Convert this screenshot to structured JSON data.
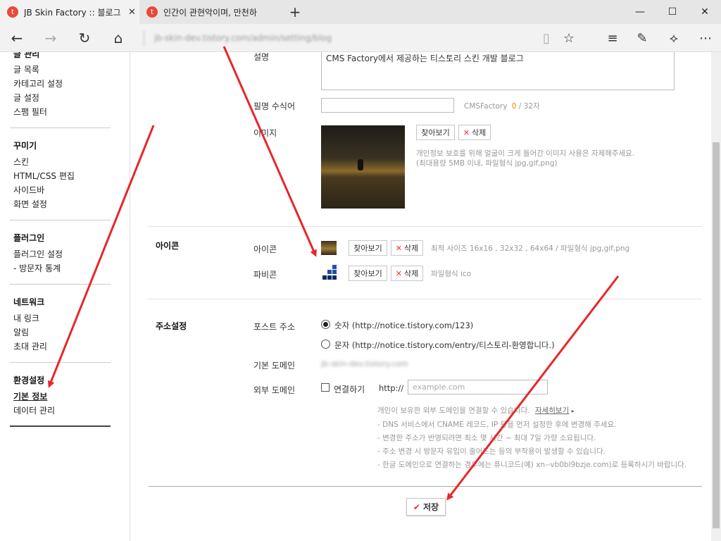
{
  "browser": {
    "tabs": [
      {
        "title": "JB Skin Factory :: 블로그",
        "icon": "tistory-icon",
        "close": "✕"
      },
      {
        "title": "인간이 관현악이며, 만천하",
        "icon": "tistory-icon"
      }
    ],
    "new_tab": "+",
    "address": "jb-skin-dev.tistory.com/admin/setting/blog"
  },
  "sidebar": {
    "top_header": "글 관리",
    "group1": [
      "글 목록",
      "카테고리 설정",
      "글 설정",
      "스팸 필터"
    ],
    "design": {
      "header": "꾸미기",
      "items": [
        "스킨",
        "HTML/CSS 편집",
        "사이드바",
        "화면 설정"
      ]
    },
    "plugin": {
      "header": "플러그인",
      "items": [
        "플러그인 설정",
        "- 방문자 통계"
      ]
    },
    "network": {
      "header": "네트워크",
      "items": [
        "내 링크",
        "알림",
        "초대 관리"
      ]
    },
    "settings": {
      "header": "환경설정",
      "items": [
        "기본 정보",
        "데이터 관리"
      ]
    }
  },
  "form": {
    "desc_label": "설명",
    "desc_value": "CMS Factory에서 제공하는 티스토리 스킨 개발 블로그",
    "nick_label": "필명 수식어",
    "nick_hint_prefix": "CMSFactory",
    "nick_count": "0",
    "nick_max": "/ 32자",
    "image_label": "이미지",
    "browse": "찾아보기",
    "delete": "삭제",
    "image_hint1": "개인정보 보호를 위해 얼굴이 크게 들어간 이미지 사용은 자제해주세요.",
    "image_hint2": "(최대용량 5MB 이내, 파일형식 jpg,gif,png)",
    "icon_section": "아이콘",
    "icon_label": "아이콘",
    "icon_hint": "최적 사이즈 16x16 , 32x32 , 64x64 / 파일형식 jpg,gif,png",
    "favicon_label": "파비콘",
    "favicon_hint": "파일형식 ico",
    "addr_section": "주소설정",
    "post_addr_label": "포스트 주소",
    "opt_number": "숫자 (http://notice.tistory.com/123)",
    "opt_text": "문자 (http://notice.tistory.com/entry/티스토리-환영합니다.)",
    "base_domain_label": "기본 도메인",
    "base_domain_value": "jb-skin-dev.tistory.com",
    "ext_domain_label": "외부 도메인",
    "connect_label": "연결하기",
    "http_prefix": "http://",
    "domain_placeholder": "example.com",
    "ext_info1": "개인이 보유한 외부 도메인을 연결할 수 있습니다.",
    "ext_more": "자세히보기",
    "ext_info2": "- DNS 서비스에서 CNAME 레코드, IP 등을 먼저 설정한 후에 변경해 주세요.",
    "ext_info3": "- 변경한 주소가 반영되려면 최소 몇 시간 ~ 최대 7일 가량 소요됩니다.",
    "ext_info4": "- 주소 변경 시 방문자 유입이 줄어드는 등의 부작용이 발생할 수 있습니다.",
    "ext_info5": "- 한글 도메인으로 연결하는 경우에는 퓨니코드(예) xn--vb0bl9bzje.com)로 등록하시기 바랍니다.",
    "save": "저장"
  },
  "colors": {
    "accent_arrow": "#e8262a",
    "brand": "#e8493a"
  }
}
